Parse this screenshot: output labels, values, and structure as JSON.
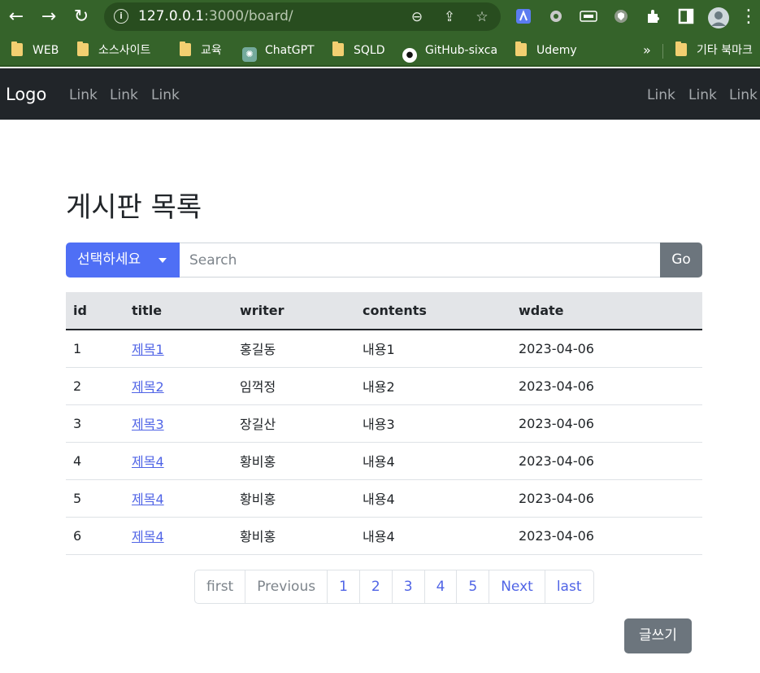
{
  "browser": {
    "url_host": "127.0.0.1",
    "url_path": ":3000/board/",
    "back_icon": "←",
    "forward_icon": "→",
    "reload_icon": "↻",
    "info_icon": "i",
    "zoom_icon": "⊖",
    "share_icon": "⇪",
    "star_icon": "☆",
    "menu_icon": "⋮",
    "bookmarks": [
      "WEB",
      "소스사이트",
      "교육",
      "ChatGPT",
      "SQLD",
      "GitHub-sixca",
      "Udemy"
    ],
    "overflow_label": "»",
    "other_bookmarks": "기타 북마크"
  },
  "navbar": {
    "brand": "Logo",
    "left_links": [
      "Link",
      "Link",
      "Link"
    ],
    "right_links": [
      "Link",
      "Link",
      "Link"
    ]
  },
  "main": {
    "title": "게시판 목록",
    "dropdown_label": "선택하세요",
    "search_placeholder": "Search",
    "go_label": "Go",
    "write_label": "글쓰기"
  },
  "table": {
    "columns": [
      "id",
      "title",
      "writer",
      "contents",
      "wdate"
    ],
    "rows": [
      {
        "id": "1",
        "title": "제목1",
        "writer": "홍길동",
        "contents": "내용1",
        "wdate": "2023-04-06"
      },
      {
        "id": "2",
        "title": "제목2",
        "writer": "임꺽정",
        "contents": "내용2",
        "wdate": "2023-04-06"
      },
      {
        "id": "3",
        "title": "제목3",
        "writer": "장길산",
        "contents": "내용3",
        "wdate": "2023-04-06"
      },
      {
        "id": "4",
        "title": "제목4",
        "writer": "황비홍",
        "contents": "내용4",
        "wdate": "2023-04-06"
      },
      {
        "id": "5",
        "title": "제목4",
        "writer": "황비홍",
        "contents": "내용4",
        "wdate": "2023-04-06"
      },
      {
        "id": "6",
        "title": "제목4",
        "writer": "황비홍",
        "contents": "내용4",
        "wdate": "2023-04-06"
      }
    ]
  },
  "pagination": [
    "first",
    "Previous",
    "1",
    "2",
    "3",
    "4",
    "5",
    "Next",
    "last"
  ],
  "colors": {
    "primary": "#4f6ff5",
    "secondary": "#6c757d",
    "navbar_bg": "#212529",
    "browser_bg": "#35632a",
    "link": "#5064e6"
  }
}
